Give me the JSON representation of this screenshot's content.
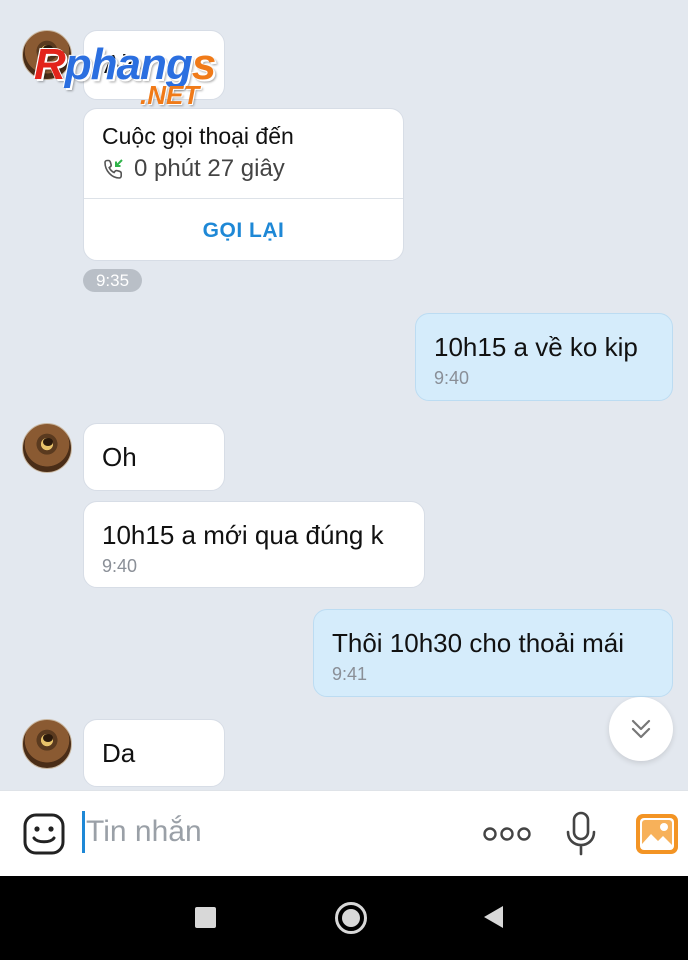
{
  "watermark": {
    "first": "R",
    "middle": "phang",
    "last": "s",
    "sub": ".NET"
  },
  "messages": {
    "m1_text": "Alo",
    "call_title": "Cuộc gọi thoại đến",
    "call_duration": "0 phút 27 giây",
    "call_action": "GỌI LẠI",
    "call_time": "9:35",
    "m2_text": "10h15 a về ko kip",
    "m2_time": "9:40",
    "m3_text": "Oh",
    "m4_text": "10h15 a mới qua đúng k",
    "m4_time": "9:40",
    "m5_text": "Thôi 10h30 cho thoải mái",
    "m5_time": "9:41",
    "m6_text": "Da"
  },
  "composer": {
    "placeholder": "Tin nhắn",
    "value": ""
  },
  "icons": {
    "emoji": "emoji-icon",
    "more": "more-dots-icon",
    "mic": "microphone-icon",
    "image": "image-icon",
    "scroll": "chevron-double-down-icon",
    "call": "incoming-call-icon"
  },
  "colors": {
    "accent": "#1e88d6",
    "own_bubble": "#d5ecfb",
    "background": "#e3e8ef",
    "image_icon": "#f39424"
  }
}
